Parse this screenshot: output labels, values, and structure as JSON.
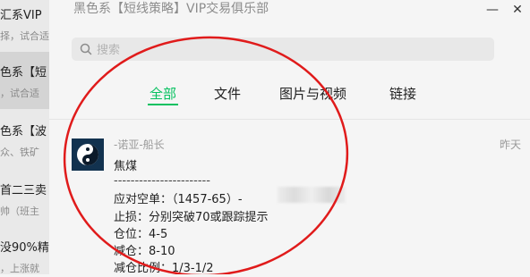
{
  "sidebar": {
    "items": [
      {
        "title": "汇系VIP",
        "preview": "择，试合适"
      },
      {
        "title": "色系【短",
        "preview": "，试合适"
      },
      {
        "title": "色系【波",
        "preview": "众、铁矿"
      },
      {
        "title": "首二三卖",
        "preview": "帅（班主"
      },
      {
        "title": "没90%精",
        "preview": "，上涨就"
      }
    ]
  },
  "window": {
    "title": "黑色系【短线策略】VIP交易俱乐部",
    "minimize": "—",
    "close": "✕"
  },
  "search": {
    "placeholder": "搜索"
  },
  "tabs": [
    {
      "label": "全部"
    },
    {
      "label": "文件"
    },
    {
      "label": "图片与视频"
    },
    {
      "label": "链接"
    }
  ],
  "result": {
    "sender": "-诺亚-船长",
    "time": "昨天",
    "lines": [
      "焦煤",
      "-----------------------",
      "应对空单：（1457-65）-",
      "止损：分别突破70或跟踪提示",
      "仓位：4-5",
      "减仓：8-10",
      "减仓比例：1/3-1/2"
    ]
  },
  "colors": {
    "accent": "#07c160",
    "annotation": "#e01b1b"
  }
}
